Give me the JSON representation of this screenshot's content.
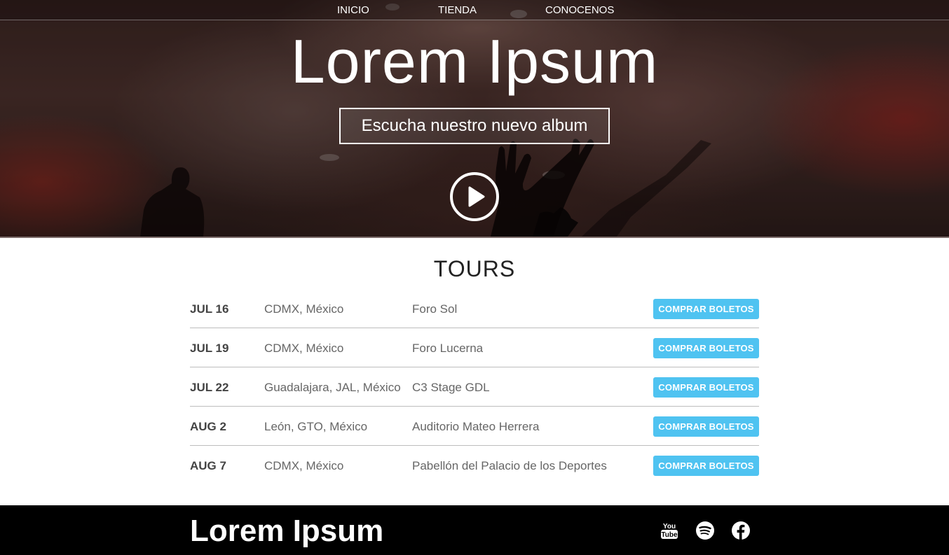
{
  "nav": {
    "items": [
      {
        "label": "INICIO"
      },
      {
        "label": "TIENDA"
      },
      {
        "label": "CONOCENOS"
      }
    ]
  },
  "hero": {
    "title": "Lorem Ipsum",
    "album_button": "Escucha nuestro nuevo album",
    "play_icon": "play-circle-icon"
  },
  "tours": {
    "title": "TOURS",
    "button_label": "COMPRAR BOLETOS",
    "rows": [
      {
        "date": "JUL 16",
        "city": "CDMX, México",
        "venue": "Foro Sol"
      },
      {
        "date": "JUL 19",
        "city": "CDMX, México",
        "venue": "Foro Lucerna"
      },
      {
        "date": "JUL 22",
        "city": "Guadalajara, JAL, México",
        "venue": "C3 Stage GDL"
      },
      {
        "date": "AUG 2",
        "city": "León, GTO, México",
        "venue": "Auditorio Mateo Herrera"
      },
      {
        "date": "AUG 7",
        "city": "CDMX, México",
        "venue": "Pabellón del Palacio de los Deportes"
      }
    ]
  },
  "footer": {
    "title": "Lorem Ipsum",
    "social": [
      {
        "icon": "youtube-icon"
      },
      {
        "icon": "spotify-icon"
      },
      {
        "icon": "facebook-icon"
      }
    ]
  },
  "colors": {
    "button_blue": "#4fc3f1",
    "footer_bg": "#000000",
    "hero_tint": "#3a2522"
  }
}
